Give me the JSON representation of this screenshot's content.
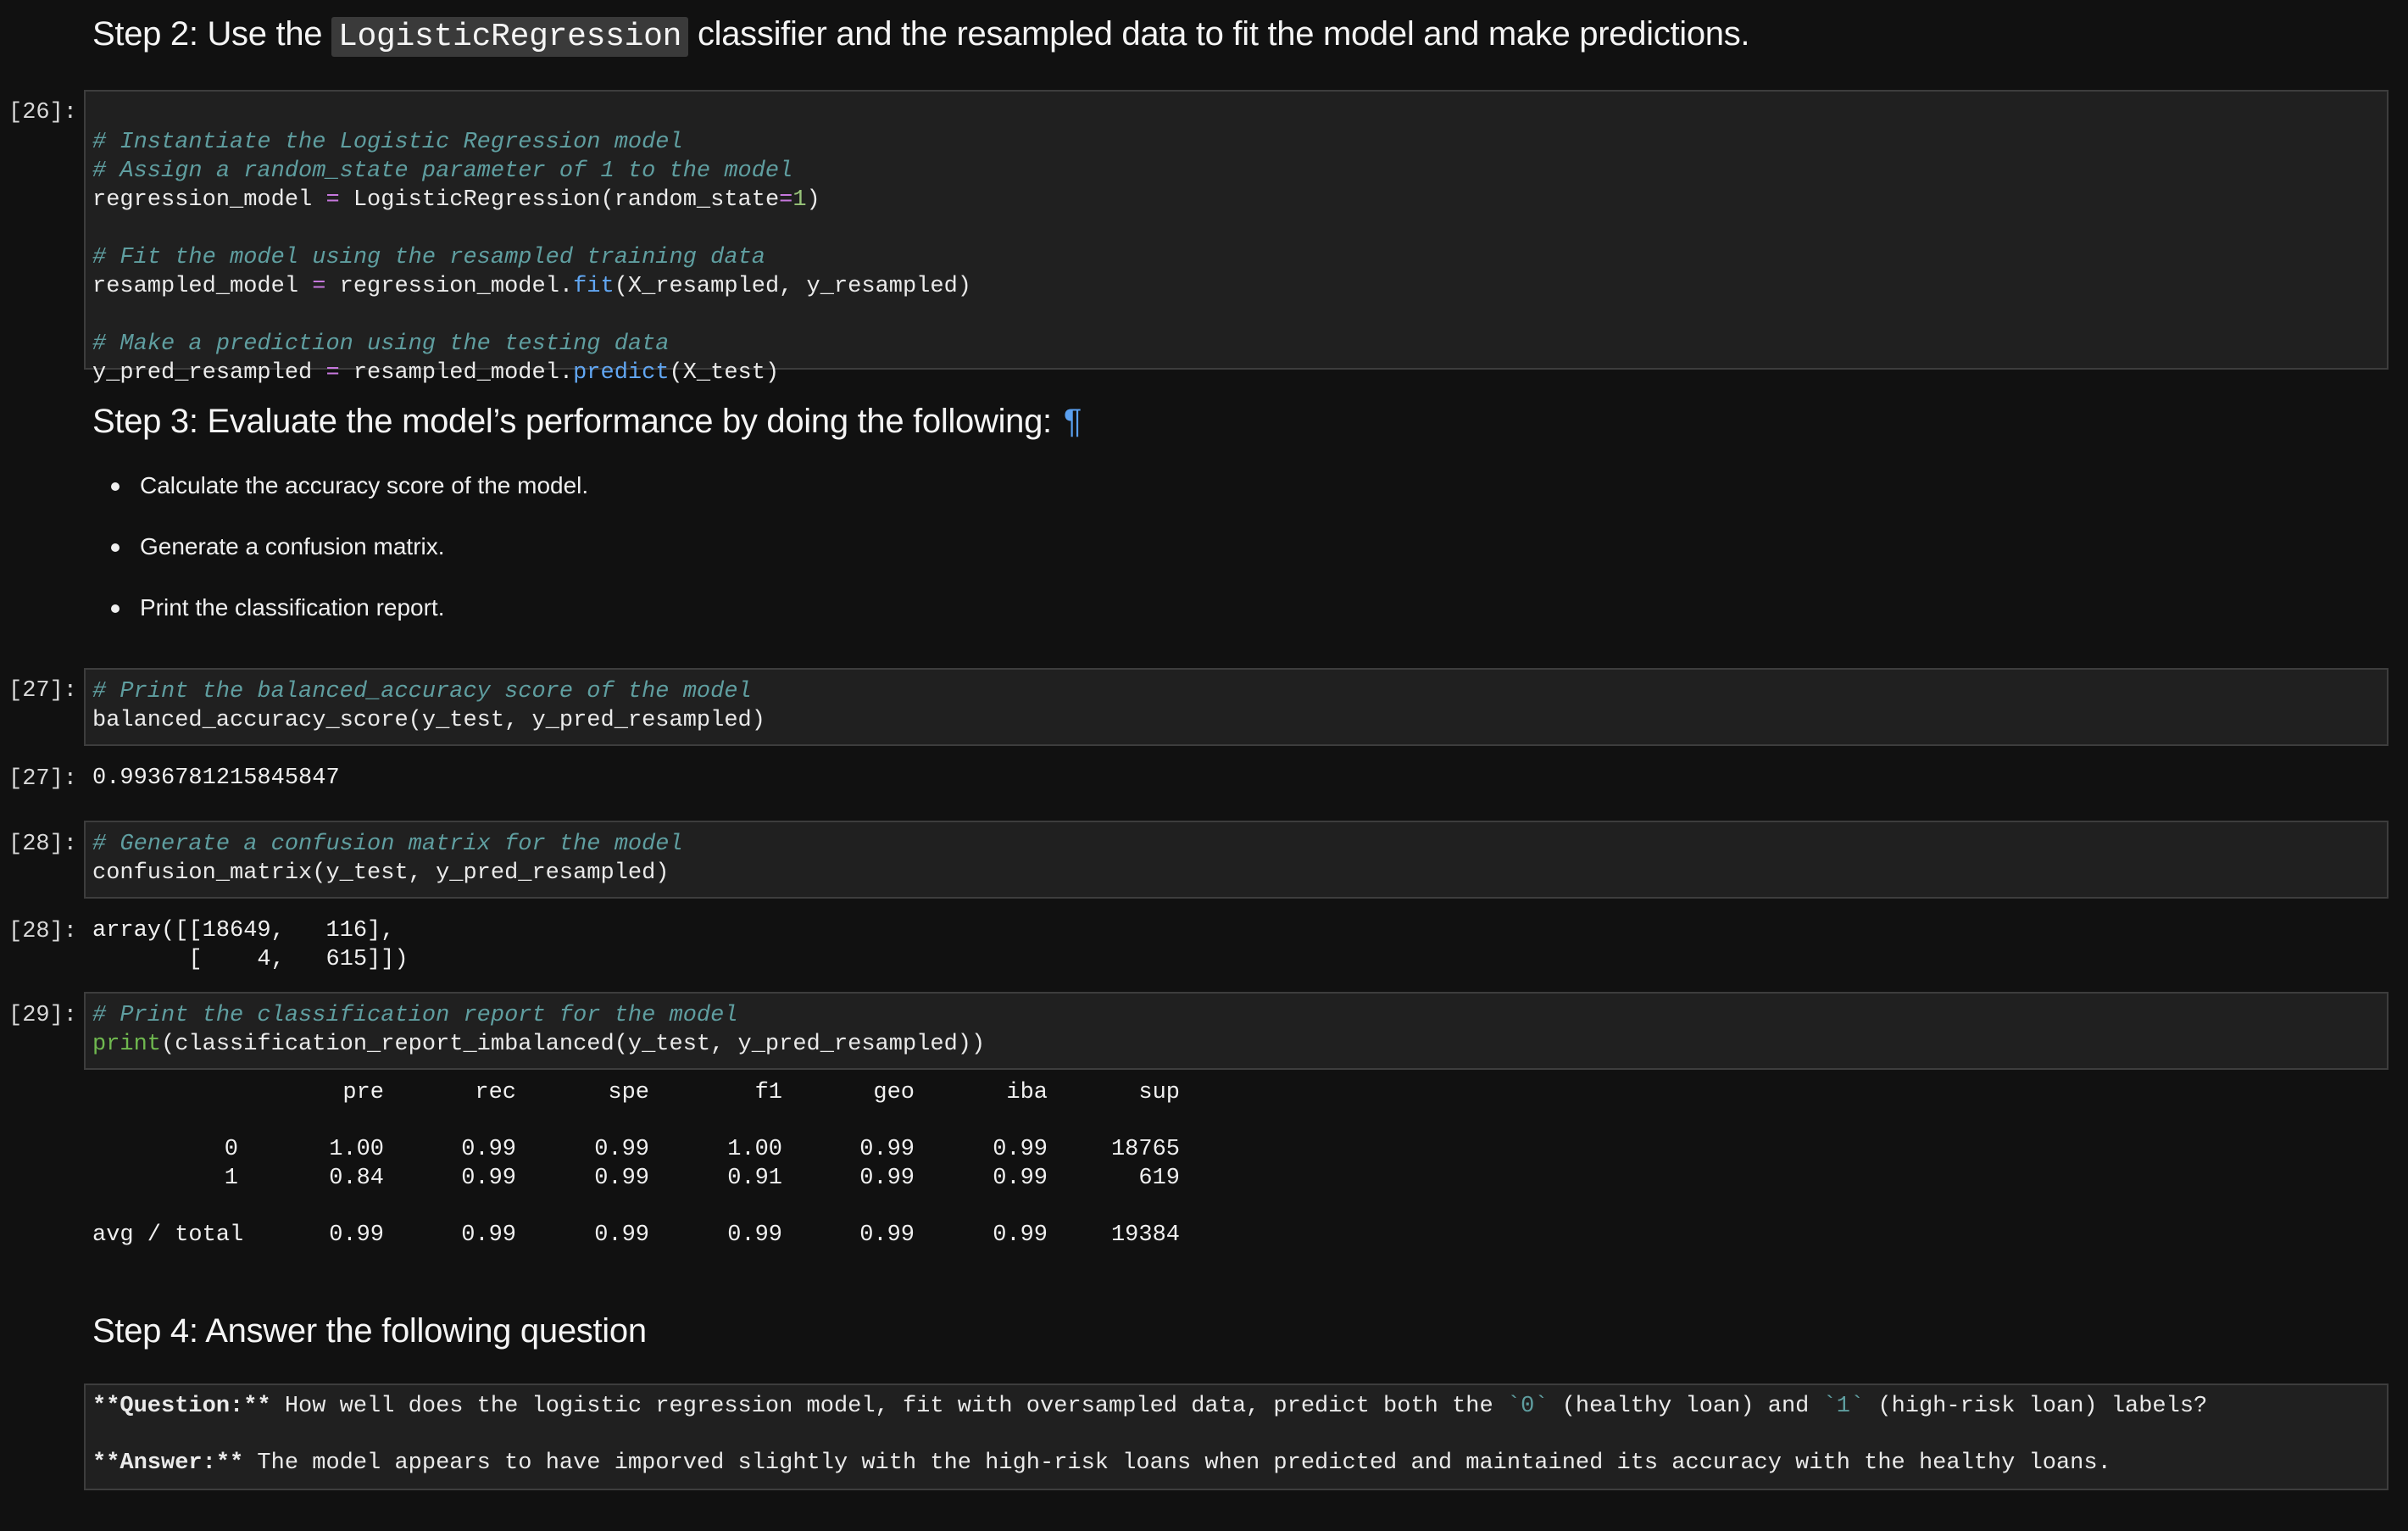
{
  "step2": {
    "prefix": "Step 2: Use the ",
    "code": "LogisticRegression",
    "suffix": " classifier and the resampled data to fit the model and make predictions."
  },
  "cell26": {
    "prompt": "[26]:",
    "lines": {
      "c1": "# Instantiate the Logistic Regression model",
      "c2": "# Assign a random_state parameter of 1 to the model",
      "l3a": "regression_model ",
      "l3op": "=",
      "l3b": " LogisticRegression(random_state",
      "l3op2": "=",
      "l3num": "1",
      "l3c": ")",
      "c5": "# Fit the model using the resampled training data",
      "l6a": "resampled_model ",
      "l6op": "=",
      "l6b": " regression_model.",
      "l6fn": "fit",
      "l6c": "(X_resampled, y_resampled)",
      "c8": "# Make a prediction using the testing data",
      "l9a": "y_pred_resampled ",
      "l9op": "=",
      "l9b": " resampled_model.",
      "l9fn": "predict",
      "l9c": "(X_test)"
    }
  },
  "step3": {
    "title": "Step 3: Evaluate the model’s performance by doing the following:",
    "pilcrow": "¶",
    "bullets": [
      "Calculate the accuracy score of the model.",
      "Generate a confusion matrix.",
      "Print the classification report."
    ]
  },
  "cell27": {
    "prompt": "[27]:",
    "comment": "# Print the balanced_accuracy score of the model",
    "code": "balanced_accuracy_score(y_test, y_pred_resampled)",
    "out_prompt": "[27]:",
    "output": "0.9936781215845847"
  },
  "cell28": {
    "prompt": "[28]:",
    "comment": "# Generate a confusion matrix for the model",
    "code": "confusion_matrix(y_test, y_pred_resampled)",
    "out_prompt": "[28]:",
    "output_line1": "array([[18649,   116],",
    "output_line2": "       [    4,   615]])"
  },
  "cell29": {
    "prompt": "[29]:",
    "comment": "# Print the classification report for the model",
    "print_kw": "print",
    "code_rest": "(classification_report_imbalanced(y_test, y_pred_resampled))",
    "report": {
      "headers": [
        "pre",
        "rec",
        "spe",
        "f1",
        "geo",
        "iba",
        "sup"
      ],
      "rows": [
        {
          "label": "0",
          "values": [
            "1.00",
            "0.99",
            "0.99",
            "1.00",
            "0.99",
            "0.99",
            "18765"
          ]
        },
        {
          "label": "1",
          "values": [
            "0.84",
            "0.99",
            "0.99",
            "0.91",
            "0.99",
            "0.99",
            "619"
          ]
        }
      ],
      "total": {
        "label": "avg / total",
        "values": [
          "0.99",
          "0.99",
          "0.99",
          "0.99",
          "0.99",
          "0.99",
          "19384"
        ]
      }
    }
  },
  "step4": {
    "title": "Step 4: Answer the following question",
    "q_label": "**Question:**",
    "q_text_a": " How well does the logistic regression model, fit with oversampled data, predict both the ",
    "q_code0": "`0`",
    "q_text_b": " (healthy loan) and ",
    "q_code1": "`1`",
    "q_text_c": " (high-risk loan) labels?",
    "a_label": "**Answer:**",
    "a_text": " The model appears to have imporved slightly with the high-risk loans when predicted and maintained its accuracy with the healthy loans."
  }
}
